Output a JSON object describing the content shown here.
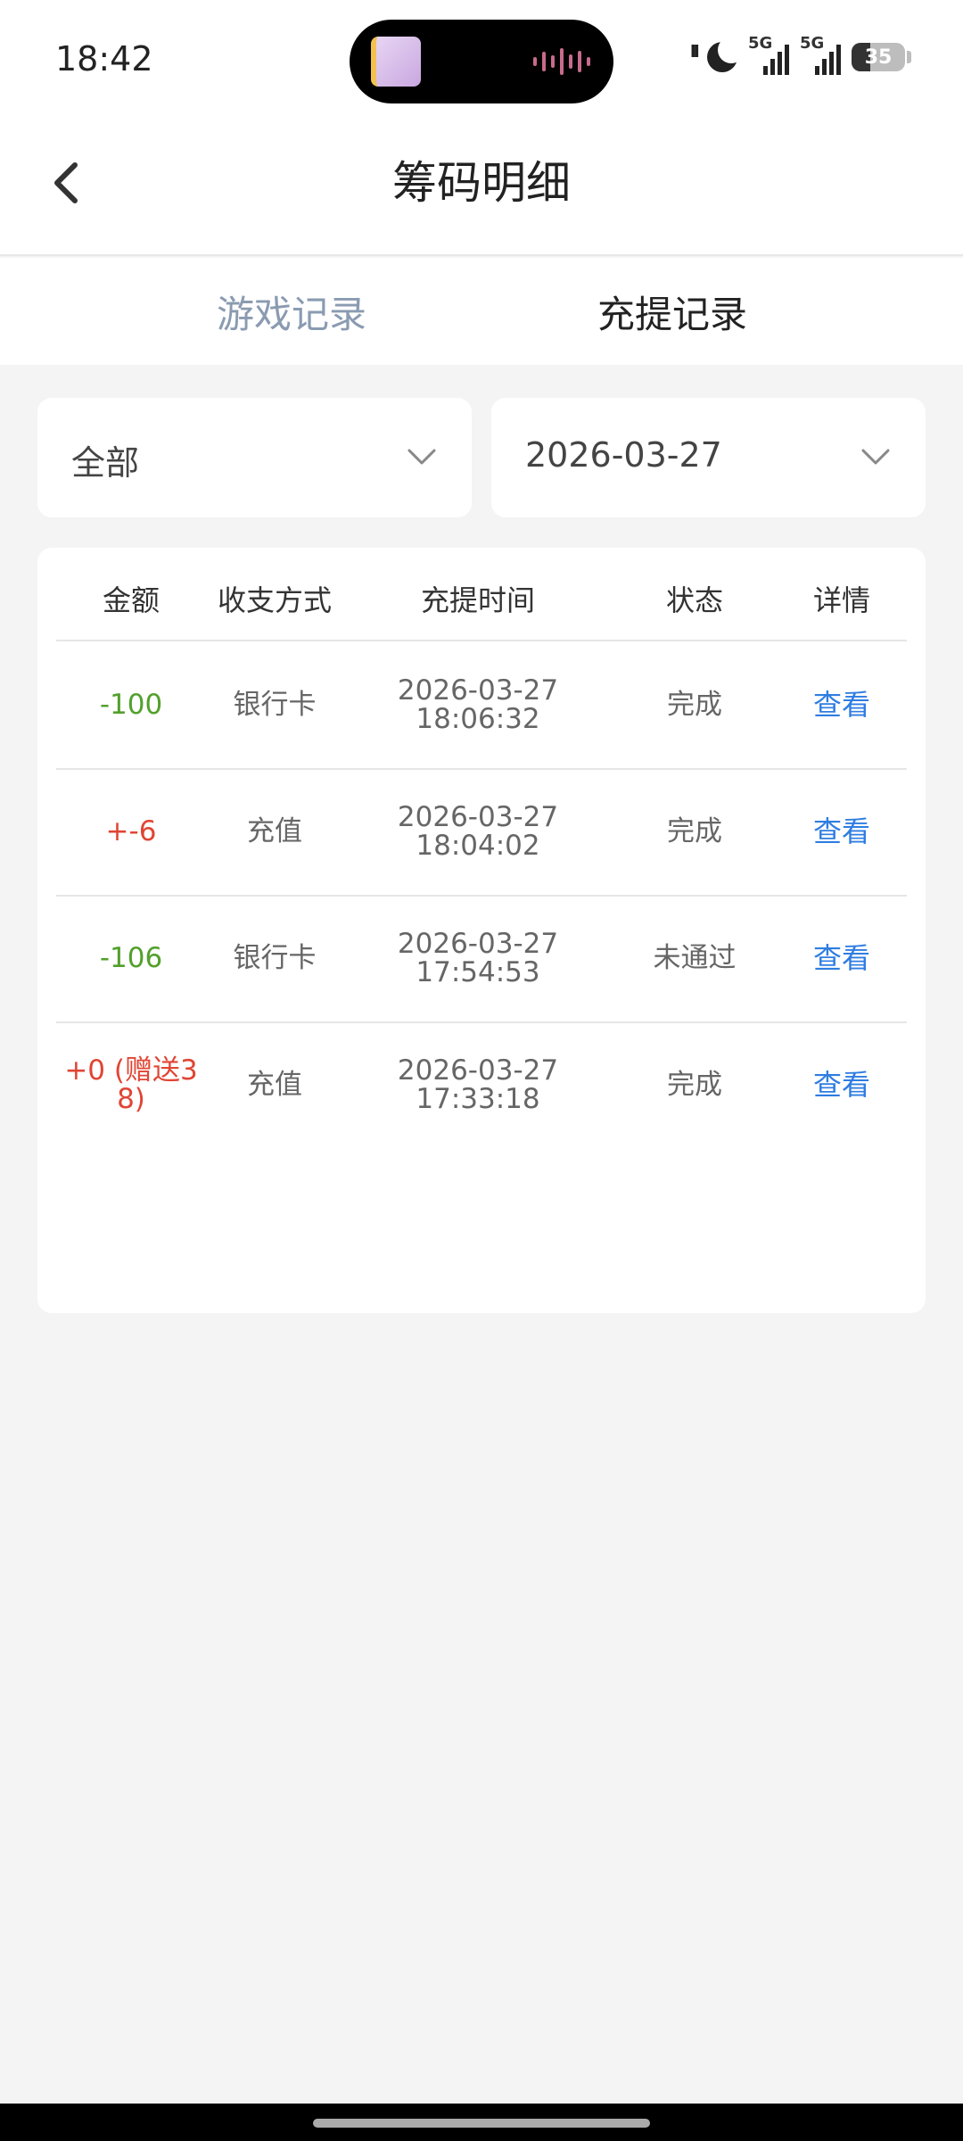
{
  "status_bar": {
    "time": "18:42",
    "network_1": "5G",
    "network_2": "5G",
    "battery": "35"
  },
  "header": {
    "title": "筹码明细"
  },
  "tabs": [
    {
      "label": "游戏记录",
      "active": false
    },
    {
      "label": "充提记录",
      "active": true
    }
  ],
  "filters": {
    "type": "全部",
    "date": "2026-03-27"
  },
  "table": {
    "columns": [
      "金额",
      "收支方式",
      "充提时间",
      "状态",
      "详情"
    ],
    "rows": [
      {
        "amount": "-100",
        "method": "银行卡",
        "date": "2026-03-27",
        "time": "18:06:32",
        "status": "完成",
        "detail": "查看"
      },
      {
        "amount": "+-6",
        "method": "充值",
        "date": "2026-03-27",
        "time": "18:04:02",
        "status": "完成",
        "detail": "查看"
      },
      {
        "amount": "-106",
        "method": "银行卡",
        "date": "2026-03-27",
        "time": "17:54:53",
        "status": "未通过",
        "detail": "查看"
      },
      {
        "amount": "+0 (赠送38)",
        "method": "充值",
        "date": "2026-03-27",
        "time": "17:33:18",
        "status": "完成",
        "detail": "查看"
      }
    ]
  },
  "colors": {
    "negative_amount": "#52a02c",
    "positive_amount": "#e04534",
    "link": "#2f7de1",
    "inactive_tab": "#8a9bb1"
  }
}
